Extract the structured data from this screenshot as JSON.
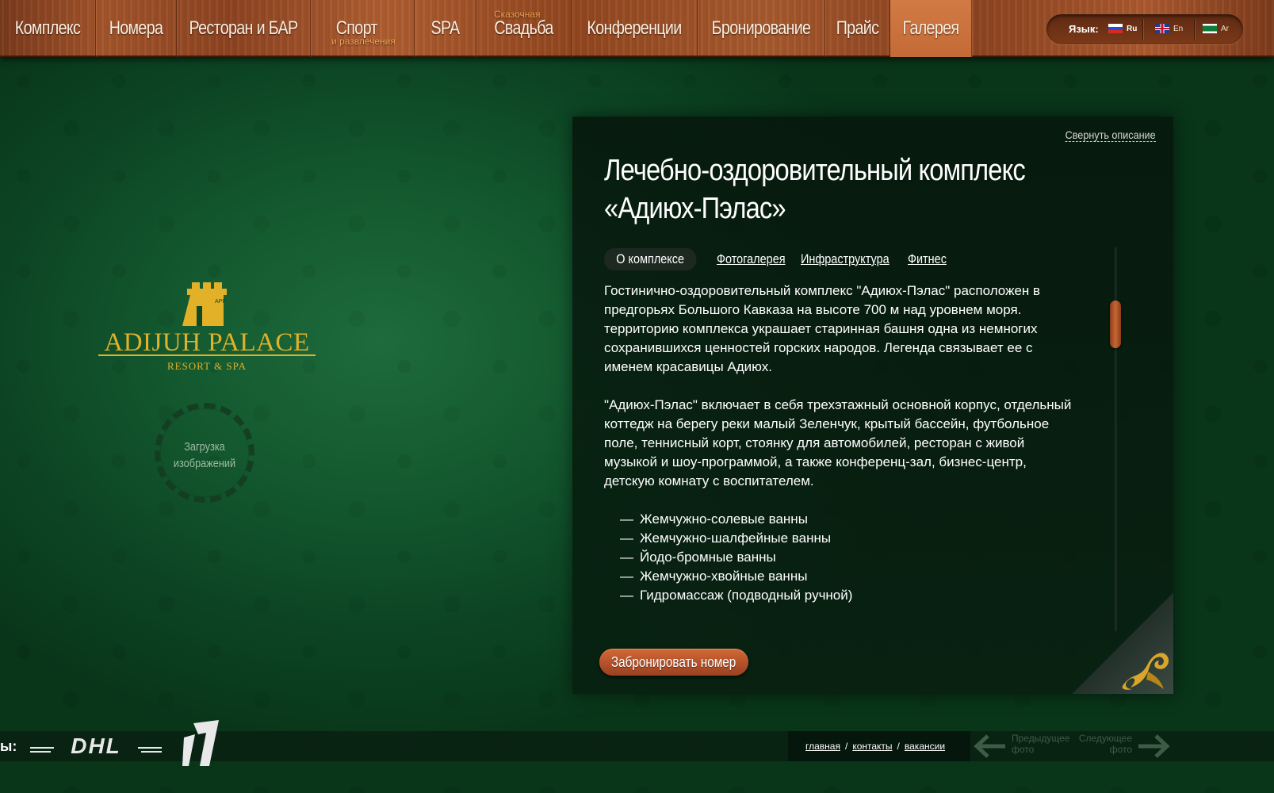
{
  "nav": {
    "items": [
      {
        "label": "Комплекс",
        "sub": ""
      },
      {
        "label": "Номера",
        "sub": ""
      },
      {
        "label": "Ресторан и БАР",
        "sub": ""
      },
      {
        "label": "Спорт",
        "sub": "и развлечения"
      },
      {
        "label": "SPA",
        "sub": ""
      },
      {
        "label": "Свадьба",
        "sub": "Сказочная"
      },
      {
        "label": "Конференции",
        "sub": ""
      },
      {
        "label": "Бронирование",
        "sub": ""
      },
      {
        "label": "Прайс",
        "sub": ""
      },
      {
        "label": "Галерея",
        "sub": ""
      }
    ],
    "active": "Галерея"
  },
  "language": {
    "title": "Язык:",
    "options": [
      "Ru",
      "En",
      "Ar"
    ],
    "selected": "Ru"
  },
  "logo": {
    "name": "ADIJUH PALACE",
    "tagline": "RESORT & SPA",
    "mark": "APP"
  },
  "loader": {
    "text_line1": "Загрузка",
    "text_line2": "изображений"
  },
  "panel": {
    "collapse_label": "Свернуть описание",
    "title_line1": "Лечебно-оздоровительный комплекс",
    "title_line2": "«Адиюх-Пэлас»",
    "tabs": [
      "О комплексе",
      "Фотогалерея",
      "Инфраструктура",
      "Фитнес"
    ],
    "active_tab": "О комплексе",
    "paragraph1": "Гостинично-оздоровительный комплекс \"Адиюх-Пэлас\" расположен в предгорьях Большого Кавказа на высоте 700 м над уровнем моря. территорию комплекса украшает старинная башня одна из немногих сохранившихся ценностей горских народов. Легенда связывает ее с именем красавицы Адиюх.",
    "paragraph2": "\"Адиюх-Пэлас\" включает в себя трехэтажный основной корпус, отдельный коттедж на берегу реки малый Зеленчук, крытый бассейн, футбольное поле, теннисный корт, стоянку для автомобилей, ресторан с живой музыкой и шоу-программой, а также конференц-зал, бизнес-центр, детскую комнату с воспитателем.",
    "list": [
      "Жемчужно-солевые ванны",
      "Жемчужно-шалфейные ванны",
      "Йодо-бромные ванны",
      "Жемчужно-хвойные ванны",
      "Гидромассаж (подводный ручной)"
    ],
    "book_button": "Забронировать номер"
  },
  "footer": {
    "partners_label": "ы:",
    "partners": [
      "DHL",
      "1"
    ],
    "links": [
      "главная",
      "контакты",
      "вакансии"
    ],
    "separator": "/",
    "prev_photo": "Предыдущее фото",
    "next_photo": "Следующее фото"
  },
  "colors": {
    "wood": "#a4552b",
    "active_tab_wood": "#d27a44",
    "green_bg": "#145a30",
    "panel_bg": "#08200f",
    "gold": "#e3b127",
    "button": "#c05a2e"
  }
}
